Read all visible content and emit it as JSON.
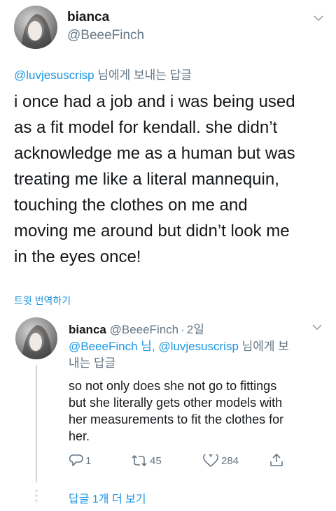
{
  "main_tweet": {
    "author_name": "bianca",
    "author_handle": "@BeeeFinch",
    "reply_to_handle": "@luvjesuscrisp",
    "reply_to_suffix": " 님에게 보내는 답글",
    "text_lines": [
      "i once had a job and i was being used",
      "as a fit model for kendall. she didn’t",
      "acknowledge me as a human but was",
      "treating me like a literal mannequin,",
      "touching the clothes on me and",
      "moving me around but didn’t look me",
      "in the eyes once!"
    ],
    "translate_label": "트윗 번역하기"
  },
  "reply_tweet": {
    "author_name": "bianca",
    "author_handle": "@BeeeFinch",
    "separator": "·",
    "time": "2일",
    "reply_line1_handles": "@BeeeFinch 님, @luvjesuscrisp",
    "reply_line1_suffix": " 님에게 보",
    "reply_line2": "내는 답글",
    "text_lines": [
      "so not only does she not go to fittings",
      "but she literally gets other models with",
      "her measurements to fit the clothes for",
      "her."
    ],
    "reply_count": "1",
    "retweet_count": "45",
    "like_count": "284"
  },
  "more_replies_label": "답글 1개 더 보기",
  "colors": {
    "accent": "#1b95e0",
    "muted": "#657786",
    "line": "#ccd6dd"
  },
  "icons": [
    "chevron-down-icon",
    "reply-icon",
    "retweet-icon",
    "heart-icon",
    "share-icon",
    "more-dots-icon"
  ]
}
